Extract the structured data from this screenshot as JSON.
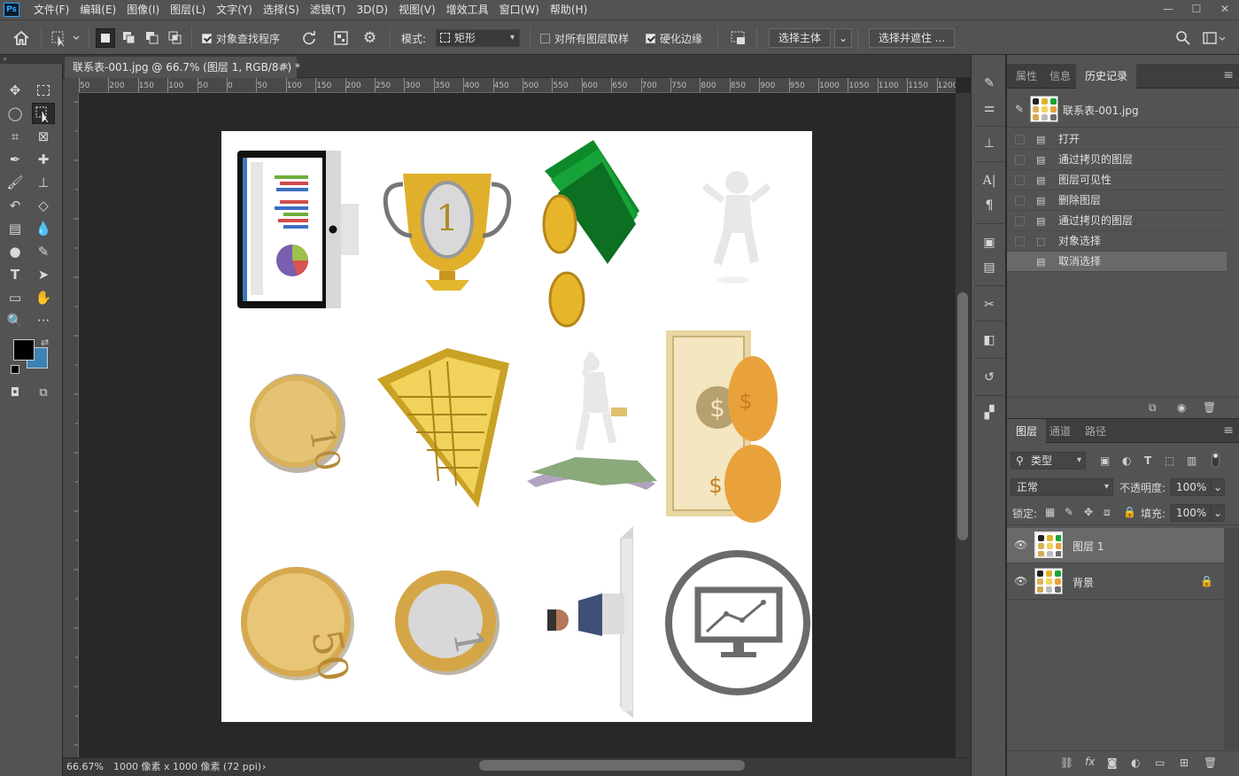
{
  "app": {
    "logo": "Ps"
  },
  "menu": [
    "文件(F)",
    "编辑(E)",
    "图像(I)",
    "图层(L)",
    "文字(Y)",
    "选择(S)",
    "滤镜(T)",
    "3D(D)",
    "视图(V)",
    "增效工具",
    "窗口(W)",
    "帮助(H)"
  ],
  "window_controls": {
    "minimize": "—",
    "restore": "☐",
    "close": "✕"
  },
  "options": {
    "object_finder_label": "对象查找程序",
    "mode_label": "模式:",
    "mode_value": "矩形",
    "sample_all_label": "对所有图层取样",
    "hard_edge_label": "硬化边缘",
    "select_subject_label": "选择主体",
    "select_mask_label": "选择并遮住 ..."
  },
  "document": {
    "tab_title": "联系表-001.jpg @ 66.7% (图层 1, RGB/8#) *",
    "close": "✕"
  },
  "ruler_top_labels": [
    "50",
    "200",
    "150",
    "100",
    "50",
    "0",
    "50",
    "100",
    "150",
    "200",
    "250",
    "300",
    "350",
    "400",
    "450",
    "500",
    "550",
    "600",
    "650",
    "700",
    "750",
    "800",
    "850",
    "900",
    "950",
    "1000",
    "1050",
    "1100",
    "1150",
    "1200"
  ],
  "status": {
    "zoom": "66.67%",
    "doc_info": "1000 像素 x 1000 像素 (72 ppi)",
    "arrow": "›"
  },
  "history_panel": {
    "tabs": [
      "属性",
      "信息",
      "历史记录"
    ],
    "active_tab": 2,
    "snapshot": "联系表-001.jpg",
    "items": [
      "打开",
      "通过拷贝的图层",
      "图层可见性",
      "删除图层",
      "通过拷贝的图层",
      "对象选择",
      "取消选择"
    ],
    "active_item": 6
  },
  "layers_panel": {
    "tabs": [
      "图层",
      "通道",
      "路径"
    ],
    "active_tab": 0,
    "filter_kind": "类型",
    "blend_mode": "正常",
    "opacity_label": "不透明度:",
    "opacity_value": "100%",
    "lock_label": "锁定:",
    "fill_label": "填充:",
    "fill_value": "100%",
    "layers": [
      {
        "name": "图层 1",
        "active": true,
        "locked": false
      },
      {
        "name": "背景",
        "active": false,
        "locked": true
      }
    ],
    "footer_icons": [
      "link-icon",
      "fx-icon",
      "mask-icon",
      "adjustment-icon",
      "folder-icon",
      "new-layer-icon",
      "trash-icon"
    ]
  },
  "colors": {
    "foreground": "#000000",
    "background": "#3d82b4",
    "ui_bg": "#535353",
    "canvas_bg": "#282828"
  }
}
